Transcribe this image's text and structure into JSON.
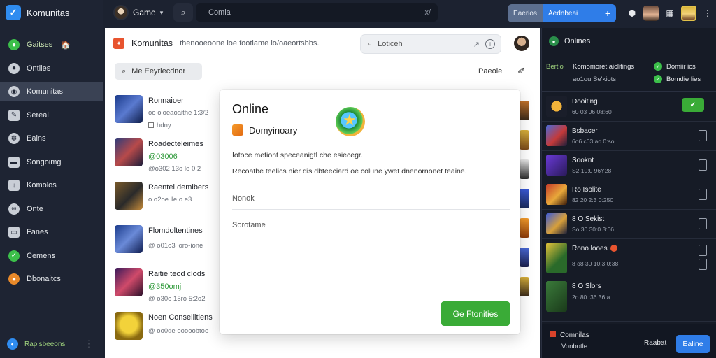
{
  "app": {
    "name": "Komunitas"
  },
  "sidebar": {
    "items": [
      {
        "label": "Gaitses",
        "icon": "green-globe-icon",
        "badge": "🏠"
      },
      {
        "label": "Ontiles",
        "icon": "user-icon"
      },
      {
        "label": "Komunitas",
        "icon": "community-icon"
      },
      {
        "label": "Sereal",
        "icon": "pencil-icon"
      },
      {
        "label": "Eains",
        "icon": "gear-icon"
      },
      {
        "label": "Songoimg",
        "icon": "card-icon"
      },
      {
        "label": "Komolos",
        "icon": "download-icon"
      },
      {
        "label": "Onte",
        "icon": "link-icon"
      },
      {
        "label": "Fanes",
        "icon": "inbox-icon"
      },
      {
        "label": "Cemens",
        "icon": "green-check-icon"
      },
      {
        "label": "Dbonaitcs",
        "icon": "orange-dot-icon"
      }
    ],
    "footer": {
      "label": "Raplsbeeons",
      "more": "⋮"
    }
  },
  "topbar": {
    "game_label": "Game",
    "search_value": "Comia",
    "search_end": "x/",
    "split_left": "Eaerios",
    "split_right": "Aednbeai",
    "split_plus": "+"
  },
  "main": {
    "title": "Komunitas",
    "subtitle": "thenooeoone   loe footiame  lo/oaeortsbbs.",
    "search_placeholder": "Loticeh",
    "search_end": "↗",
    "filter_label": "Me Eeyrlecdnor",
    "people_link": "Paeole",
    "list": [
      {
        "title": "Ronnaioer",
        "meta": "oo oloeaoaithe 1:3/2",
        "sub": "hdny"
      },
      {
        "title": "Roadecteleimes",
        "meta": "@03006",
        "sub": "@o302 13o le 0:2"
      },
      {
        "title": "Raentel demibers",
        "meta": "",
        "sub": "o o2oe lle o e3"
      },
      {
        "title": "Flomdoltentines",
        "meta": "",
        "sub": "@ o01o3 ioro-ione"
      },
      {
        "title": "Raitie teod clods",
        "meta": "@350omj",
        "sub": "@ o30o 15ro 5:2o2"
      },
      {
        "title": "Noen Conseilitiens",
        "meta": "",
        "sub": "@ oo0de ooooobtoe"
      }
    ]
  },
  "modal": {
    "title": "Online",
    "row_label": "Domyinoary",
    "p1": "Iotoce metiont speceanigtl che esiecegr.",
    "p2": "Recoatbe teelics nier dis dbteeciard oe colune ywet dnenornonet teaine.",
    "field1": "Nonok",
    "field2": "Sorotame",
    "cta": "Ge Ftonities"
  },
  "right": {
    "head": "Onlines",
    "top": {
      "l1": "Bertio",
      "l2": "Komomoret aiclitings",
      "l3": "ao1ou Se'kiots",
      "t1": "Domiir ics",
      "t2": "Bomdie lies"
    },
    "items": [
      {
        "name": "Dooiting",
        "meta": "60 03 06 08:60",
        "action": "green"
      },
      {
        "name": "Bsbacer",
        "meta": "6o6 c03 ao 0:so",
        "action": "doc"
      },
      {
        "name": "Sooknt",
        "meta": "S2 10:0 96Y28",
        "action": "doc"
      },
      {
        "name": "Ro Isolite",
        "meta": "82 20 2:3 0:250",
        "action": "doc"
      },
      {
        "name": "8 O Sekist",
        "meta": "So 30 30:0 3:06",
        "action": "doc"
      }
    ],
    "big": [
      {
        "name": "Rono looes",
        "meta": "8 o8 30 10:3 0:38"
      },
      {
        "name": "8 O Slors",
        "meta": "2o 80 :36 36:a"
      }
    ],
    "footer": {
      "f1": "Comnilas",
      "f2": "Vonbotle",
      "f3": "Raabat",
      "button": "Ealine"
    }
  }
}
